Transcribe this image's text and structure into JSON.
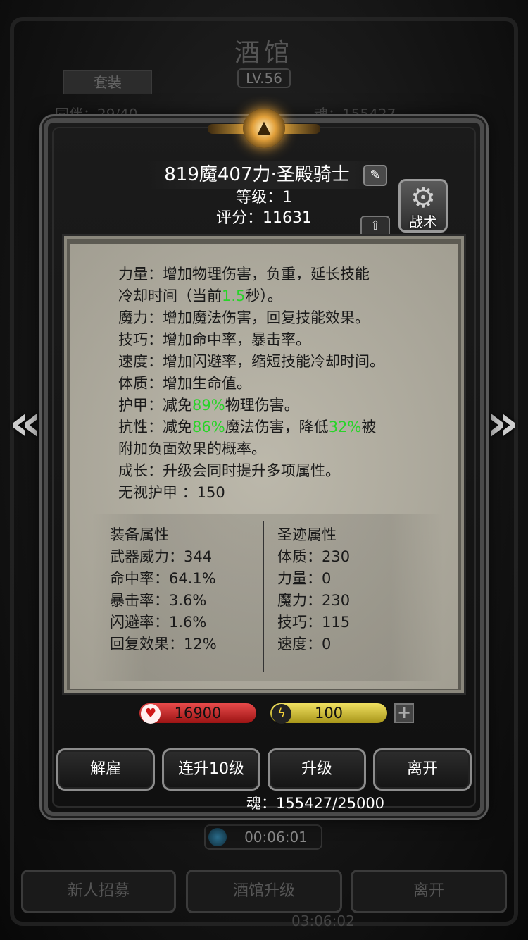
{
  "background": {
    "title": "酒馆",
    "level": "LV.56",
    "suit_tab": "套装",
    "count_text": "同伴：29/40",
    "soul_text": "魂：155427",
    "timer": "00:06:01",
    "buttons": [
      "新人招募",
      "酒馆升级",
      "离开"
    ],
    "bottom_time": "03:06:02"
  },
  "hero": {
    "name": "819魔407力·圣殿骑士",
    "level_line": "等级：1",
    "score_line": "评分：11631",
    "tactic_label": "战术"
  },
  "description": {
    "l1": "力量：增加物理伤害，负重，延长技能",
    "l2a": "冷却时间（当前",
    "l2v": "1.5",
    "l2b": "秒）。",
    "l3": "魔力：增加魔法伤害，回复技能效果。",
    "l4": "技巧：增加命中率，暴击率。",
    "l5": "速度：增加闪避率，缩短技能冷却时间。",
    "l6": "体质：增加生命值。",
    "l7a": "护甲：减免",
    "l7v": "89%",
    "l7b": "物理伤害。",
    "l8a": "抗性：减免",
    "l8v1": "86%",
    "l8b": "魔法伤害，降低",
    "l8v2": "32%",
    "l8c": "被",
    "l9": "附加负面效果的概率。",
    "l10": "成长：升级会同时提升多项属性。",
    "l11": "无视护甲 ：150"
  },
  "equipment": {
    "title": "装备属性",
    "lines": [
      "武器威力：344",
      "命中率：64.1%",
      "暴击率：3.6%",
      "闪避率：1.6%",
      "回复效果：12%"
    ]
  },
  "relic": {
    "title": "圣迹属性",
    "lines": [
      "体质：230",
      "力量：0",
      "魔力：230",
      "技巧：115",
      "速度：0"
    ]
  },
  "resources": {
    "hp": "16900",
    "energy": "100"
  },
  "actions": {
    "dismiss": "解雇",
    "level_up_10": "连升10级",
    "level_up": "升级",
    "leave": "离开"
  },
  "soul_line": "魂：155427/25000",
  "colors": {
    "highlight_green": "#28d428",
    "hp_red": "#c82020",
    "energy_yellow": "#e0cc38",
    "parchment": "#b8b4a6"
  },
  "icons": {
    "edit": "pencil-edit-icon",
    "tactic": "gear-icon",
    "upload": "upload-icon",
    "hp": "heart-icon",
    "energy": "lightning-icon",
    "prev": "double-chevron-left-icon",
    "next": "double-chevron-right-icon"
  }
}
